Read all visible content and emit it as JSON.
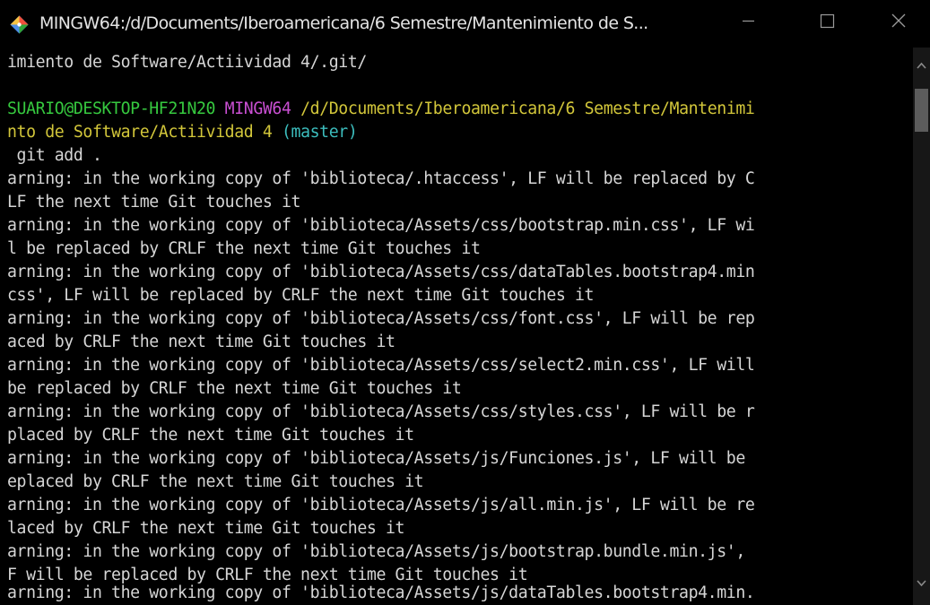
{
  "window": {
    "title": "MINGW64:/d/Documents/Iberoamericana/6 Semestre/Mantenimiento de S...",
    "icon": "git-bash-icon",
    "controls": {
      "minimize_icon": "minimize-icon",
      "maximize_icon": "maximize-icon",
      "close_icon": "close-icon"
    }
  },
  "colors": {
    "user_host": "#36c93f",
    "shell": "#c94fd2",
    "path": "#d2c63a",
    "branch": "#3cbdbd",
    "text": "#d6d6d6",
    "background": "#000000"
  },
  "terminal": {
    "line0": "imiento de Software/Actiividad 4/.git/",
    "prompt": {
      "user_host": "SUARIO@DESKTOP-HF21N20",
      "shell": "MINGW64",
      "path_part1": "/d/Documents/Iberoamericana/6 Semestre/Mantenimi",
      "path_part2": "nto de Software/Actiividad 4",
      "branch": "(master)"
    },
    "command": " git add .",
    "lines": [
      "arning: in the working copy of 'biblioteca/.htaccess', LF will be replaced by C",
      "LF the next time Git touches it",
      "arning: in the working copy of 'biblioteca/Assets/css/bootstrap.min.css', LF wi",
      "l be replaced by CRLF the next time Git touches it",
      "arning: in the working copy of 'biblioteca/Assets/css/dataTables.bootstrap4.min",
      "css', LF will be replaced by CRLF the next time Git touches it",
      "arning: in the working copy of 'biblioteca/Assets/css/font.css', LF will be rep",
      "aced by CRLF the next time Git touches it",
      "arning: in the working copy of 'biblioteca/Assets/css/select2.min.css', LF will",
      "be replaced by CRLF the next time Git touches it",
      "arning: in the working copy of 'biblioteca/Assets/css/styles.css', LF will be r",
      "placed by CRLF the next time Git touches it",
      "arning: in the working copy of 'biblioteca/Assets/js/Funciones.js', LF will be",
      "eplaced by CRLF the next time Git touches it",
      "arning: in the working copy of 'biblioteca/Assets/js/all.min.js', LF will be re",
      "laced by CRLF the next time Git touches it",
      "arning: in the working copy of 'biblioteca/Assets/js/bootstrap.bundle.min.js',",
      "F will be replaced by CRLF the next time Git touches it",
      "arning: in the working copy of 'biblioteca/Assets/js/dataTables.bootstrap4.min."
    ]
  },
  "scrollbar": {
    "up_icon": "scroll-up-arrow-icon",
    "down_icon": "scroll-down-arrow-icon"
  }
}
